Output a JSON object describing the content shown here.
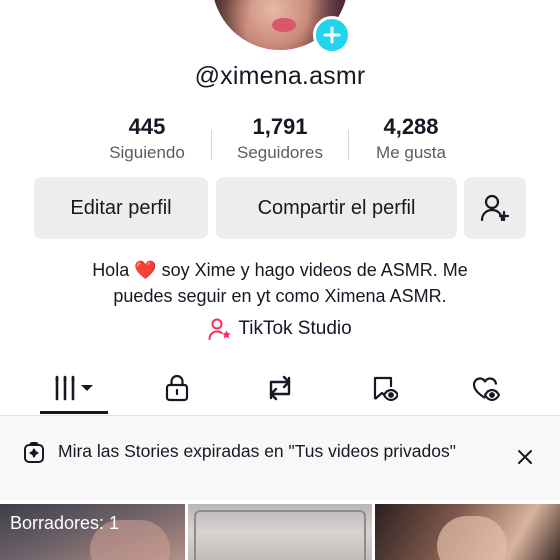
{
  "profile": {
    "username": "@ximena.asmr"
  },
  "stats": [
    {
      "value": "445",
      "label": "Siguiendo"
    },
    {
      "value": "1,791",
      "label": "Seguidores"
    },
    {
      "value": "4,288",
      "label": "Me gusta"
    }
  ],
  "buttons": {
    "edit": "Editar perfil",
    "share": "Compartir el perfil"
  },
  "bio": {
    "line1_pre": "Hola ",
    "line1_emoji": "❤️",
    "line1_post": " soy Xime y hago videos de ASMR. Me",
    "line2": "puedes seguir en yt como Ximena ASMR."
  },
  "studio": {
    "label": "TikTok Studio"
  },
  "tabs": [
    "videos-grid",
    "private",
    "reposts",
    "favorites",
    "liked"
  ],
  "banner": {
    "text": "Mira las Stories expiradas en \"Tus videos privados\""
  },
  "grid": {
    "drafts_label": "Borradores: 1"
  },
  "colors": {
    "accent": "#20d5ec",
    "studio_pink": "#fe2c55",
    "button_bg": "#ededee"
  }
}
